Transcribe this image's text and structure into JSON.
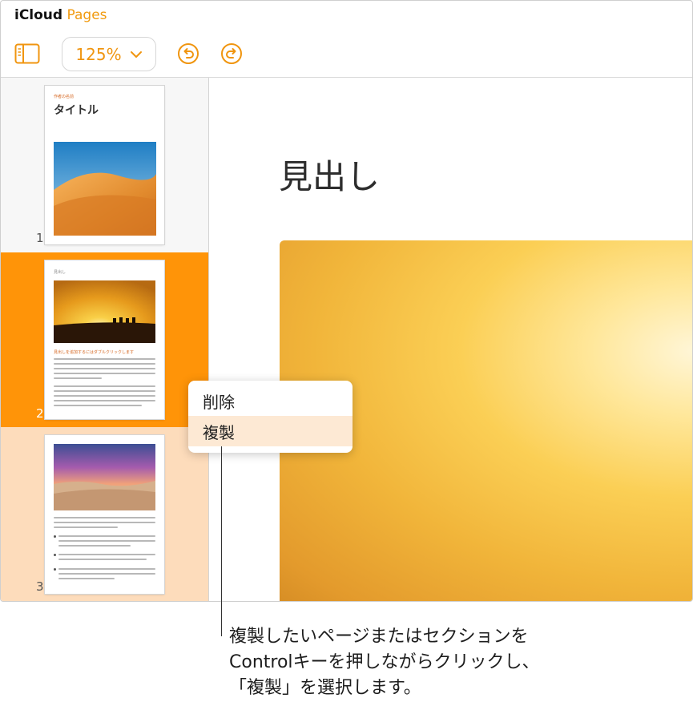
{
  "app": {
    "brand": "iCloud",
    "product": "Pages"
  },
  "toolbar": {
    "sidebar_icon": "sidebar-icon",
    "zoom": "125%",
    "zoom_icon": "chevron-down-icon",
    "undo_icon": "undo-icon",
    "redo_icon": "redo-icon",
    "accent": "#F0950F"
  },
  "sidebar": {
    "pages": [
      {
        "number": "1",
        "small_label": "作者の名前",
        "title": "タイトル",
        "state": "normal"
      },
      {
        "number": "2",
        "heading": "見出し",
        "subheading": "見出しを追加するにはダブルクリックします",
        "state": "selected"
      },
      {
        "number": "3",
        "state": "secondary"
      }
    ],
    "selected_color": "#FF9408",
    "secondary_color": "#FDDCBB"
  },
  "canvas": {
    "heading": "見出し"
  },
  "context_menu": {
    "items": [
      {
        "label": "削除",
        "highlighted": false
      },
      {
        "label": "複製",
        "highlighted": true
      }
    ]
  },
  "caption": {
    "lines": [
      "複製したいページまたはセクションを",
      "Controlキーを押しながらクリックし、",
      "「複製」を選択します。"
    ]
  }
}
